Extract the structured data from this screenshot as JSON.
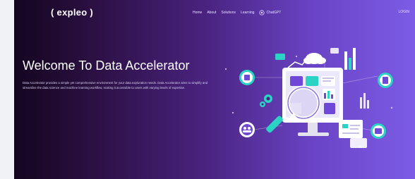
{
  "header": {
    "logo_text": "( expleo )",
    "nav_items": [
      "Home",
      "About",
      "Solutions",
      "Learning"
    ],
    "chatgpt_label": "ChatGPT",
    "login_label": "LOGIN"
  },
  "hero": {
    "title": "Welcome To Data Accelerator",
    "description": "Data Accelerator provides a simple yet comprehensive environment for your data exploration needs. Data Accelerator aims to simplify and streamline the data science and machine learning workflow, making it accessible to users with varying levels of expertise."
  },
  "colors": {
    "gradient_start": "#14051f",
    "gradient_mid": "#4a2380",
    "gradient_end": "#7c5ce6",
    "accent_teal": "#2bd3c4",
    "accent_purple": "#6f48d8"
  },
  "icons": [
    "chatgpt-icon",
    "data-analytics-illustration"
  ]
}
